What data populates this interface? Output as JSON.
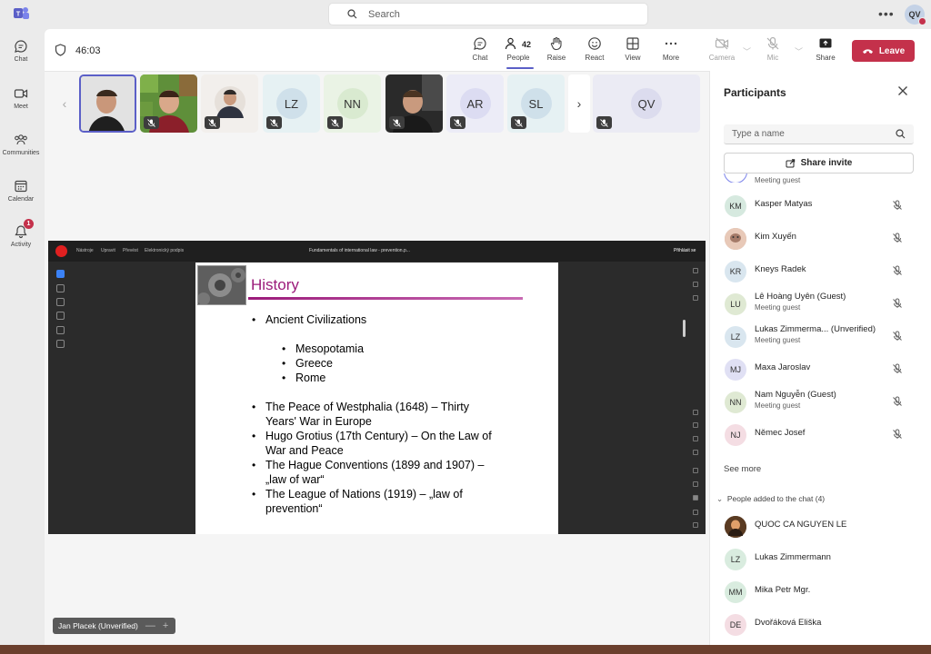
{
  "topbar": {
    "search_placeholder": "Search",
    "more_label": "•••",
    "user_initials": "QV"
  },
  "rail": [
    {
      "label": "Chat",
      "icon": "chat-icon"
    },
    {
      "label": "Meet",
      "icon": "video-camera-icon"
    },
    {
      "label": "Communities",
      "icon": "communities-icon"
    },
    {
      "label": "Calendar",
      "icon": "calendar-icon"
    },
    {
      "label": "Activity",
      "icon": "bell-icon",
      "badge": "1"
    }
  ],
  "toolbar": {
    "timer": "46:03",
    "people_count": "42",
    "buttons": [
      {
        "label": "Chat",
        "icon": "chat-icon"
      },
      {
        "label": "People",
        "icon": "people-icon"
      },
      {
        "label": "Raise",
        "icon": "raise-hand-icon"
      },
      {
        "label": "React",
        "icon": "smiley-icon"
      },
      {
        "label": "View",
        "icon": "grid-view-icon"
      },
      {
        "label": "More",
        "icon": "more-icon"
      },
      {
        "label": "Camera",
        "icon": "camera-off-icon"
      },
      {
        "label": "Mic",
        "icon": "mic-off-icon"
      },
      {
        "label": "Share",
        "icon": "share-screen-icon"
      }
    ],
    "leave_label": "Leave"
  },
  "video_tiles": [
    {
      "type": "video",
      "muted": false
    },
    {
      "type": "video",
      "muted": true
    },
    {
      "type": "video",
      "muted": true
    },
    {
      "type": "initials",
      "initials": "LZ",
      "muted": true
    },
    {
      "type": "initials",
      "initials": "NN",
      "muted": true
    },
    {
      "type": "video",
      "muted": true
    },
    {
      "type": "initials",
      "initials": "AR",
      "muted": true
    },
    {
      "type": "initials",
      "initials": "SL",
      "muted": true
    },
    {
      "type": "initials",
      "initials": "QV",
      "muted": true
    }
  ],
  "shared_screen": {
    "menu": [
      "Nástroje",
      "Upravit",
      "Převést",
      "Elektronický podpis"
    ],
    "doc_title": "Fundamentals of international law - prevention.p...",
    "signin_label": "Přihlásit se",
    "slide": {
      "title": "History",
      "items": [
        "Ancient Civilizations",
        "Mesopotamia",
        "Greece",
        "Rome",
        "The Peace of Westphalia (1648) – Thirty",
        "Years' War in Europe",
        "Hugo Grotius (17th Century) – On the Law of",
        "War and Peace",
        "The Hague Conventions (1899 and 1907) –",
        "„law of war“",
        "The League of Nations (1919) – „law of",
        "prevention“"
      ]
    }
  },
  "presenter_label": "Jan Placek (Unverified)",
  "participants": {
    "title": "Participants",
    "search_placeholder": "Type a name",
    "share_invite_label": "Share invite",
    "clipped_subtitle": "Meeting guest",
    "rows": [
      {
        "initials": "KM",
        "name": "Kasper Matyas",
        "sub": "",
        "color": "#d6e9df"
      },
      {
        "initials": "",
        "name": "Kim Xuyến",
        "sub": "",
        "color": "#c8a79a"
      },
      {
        "initials": "KR",
        "name": "Kneys Radek",
        "sub": "",
        "color": "#d9e6ef"
      },
      {
        "initials": "LU",
        "name": "Lê Hoàng Uyên (Guest)",
        "sub": "Meeting guest",
        "color": "#dfe9d3"
      },
      {
        "initials": "LZ",
        "name": "Lukas Zimmerma... (Unverified)",
        "sub": "Meeting guest",
        "color": "#d9e6ef"
      },
      {
        "initials": "MJ",
        "name": "Maxa Jaroslav",
        "sub": "",
        "color": "#e0e0f4"
      },
      {
        "initials": "NN",
        "name": "Nam Nguyễn (Guest)",
        "sub": "Meeting guest",
        "color": "#dfe9d3"
      },
      {
        "initials": "NJ",
        "name": "Němec Josef",
        "sub": "",
        "color": "#f4dde3"
      }
    ],
    "see_more_label": "See more",
    "added_header": "People added to the chat (4)",
    "added_rows": [
      {
        "initials": "",
        "name": "QUOC CA NGUYEN LE",
        "color": "#5a3b22"
      },
      {
        "initials": "LZ",
        "name": "Lukas Zimmermann",
        "color": "#d9ecdf"
      },
      {
        "initials": "MM",
        "name": "Mika Petr Mgr.",
        "color": "#d9ecdf"
      },
      {
        "initials": "DE",
        "name": "Dvořáková Eliška",
        "color": "#f4dde3"
      }
    ]
  }
}
